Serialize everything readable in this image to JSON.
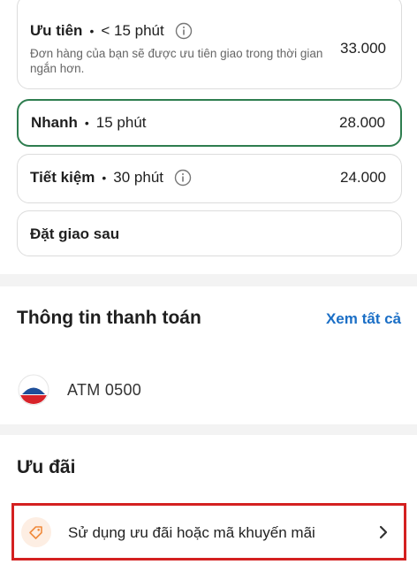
{
  "delivery_options": [
    {
      "name": "Ưu tiên",
      "eta": "< 15 phút",
      "description": "Đơn hàng của bạn sẽ được ưu tiên giao trong thời gian ngắn hơn.",
      "price": "33.000",
      "has_info": true,
      "selected": false
    },
    {
      "name": "Nhanh",
      "eta": "15 phút",
      "price": "28.000",
      "has_info": false,
      "selected": true
    },
    {
      "name": "Tiết kiệm",
      "eta": "30 phút",
      "price": "24.000",
      "has_info": true,
      "selected": false
    },
    {
      "name": "Đặt giao sau",
      "selected": false
    }
  ],
  "payment": {
    "title": "Thông tin thanh toán",
    "see_all": "Xem tất cả",
    "method_icon": "bank-logo-icon",
    "method_label": "ATM 0500"
  },
  "promo": {
    "title": "Ưu đãi",
    "icon": "tag-icon",
    "row_label": "Sử dụng ưu đãi hoặc mã khuyến mãi",
    "chevron_icon": "chevron-right-icon"
  },
  "colors": {
    "selected_border": "#2e7d4f",
    "link": "#1b6fc6",
    "highlight_box": "#d42020",
    "tag_icon": "#f08a3c",
    "bank_blue": "#1e4f9a",
    "bank_red": "#d8232a"
  }
}
